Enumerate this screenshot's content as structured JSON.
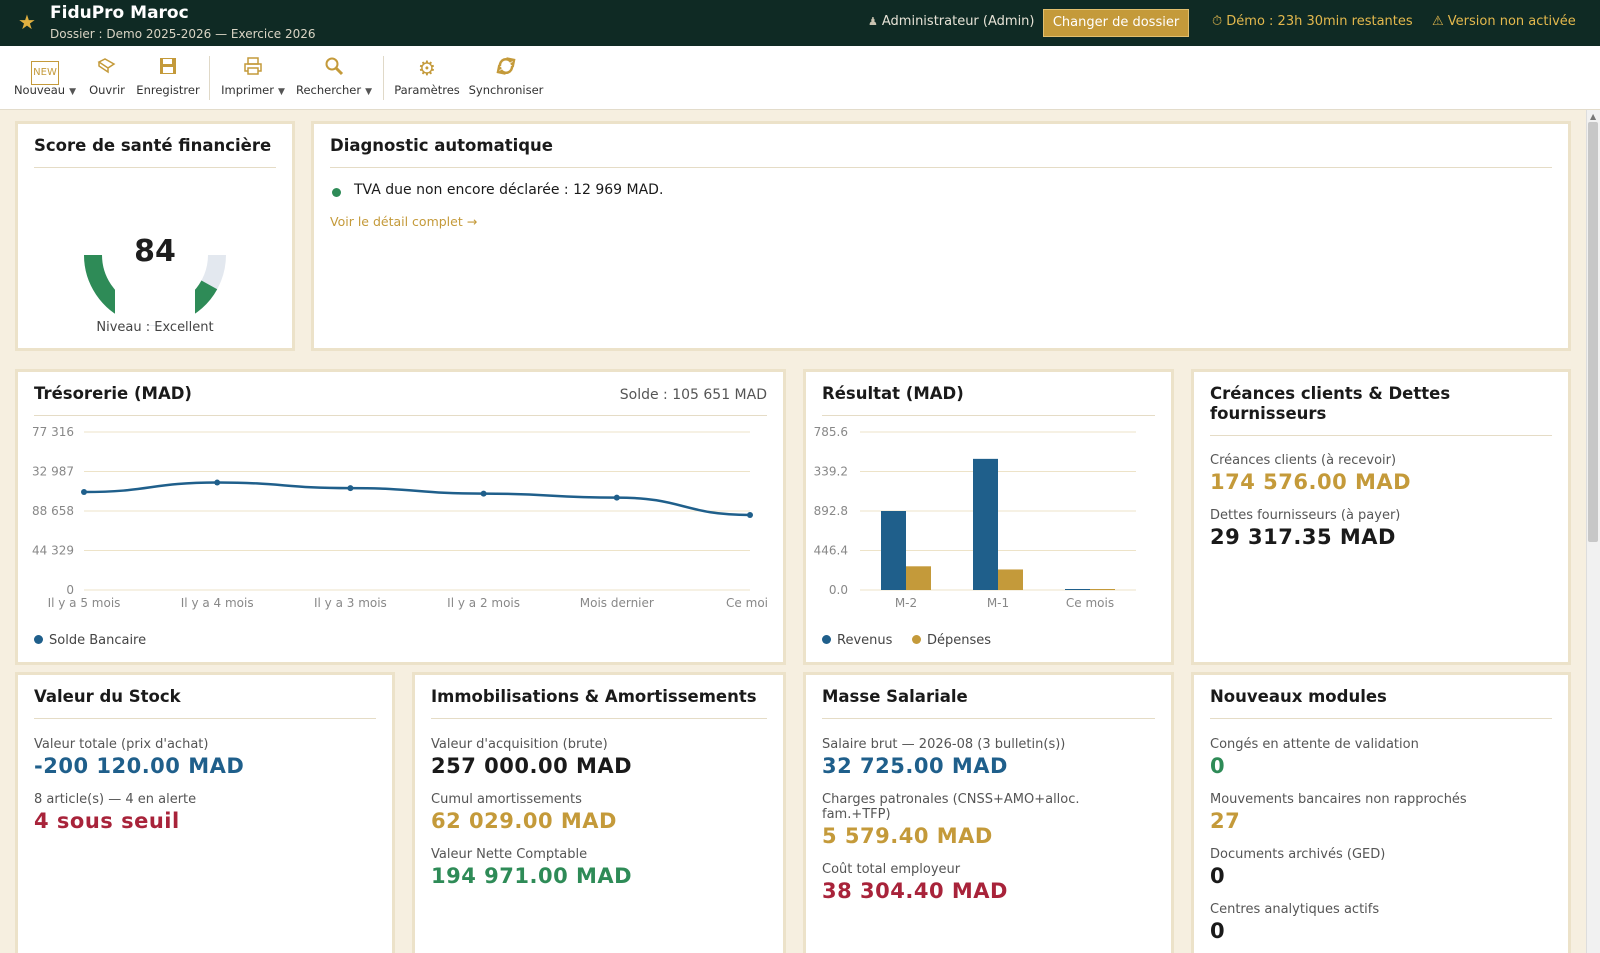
{
  "header": {
    "app_title": "FiduPro Maroc",
    "subtitle": "Dossier : Demo 2025-2026 — Exercice 2026",
    "user": "Administrateur (Admin)",
    "change_button": "Changer de dossier",
    "demo_status": "⏱ Démo : 23h 30min restantes",
    "version_status": "⚠ Version non activée"
  },
  "toolbar": {
    "new_label": "Nouveau",
    "new_icon_text": "NEW",
    "open_label": "Ouvrir",
    "save_label": "Enregistrer",
    "print_label": "Imprimer",
    "search_label": "Rechercher",
    "settings_label": "Paramètres",
    "sync_label": "Synchroniser"
  },
  "health": {
    "title": "Score de santé financière",
    "score": "84",
    "score_value": 84,
    "level": "Niveau : Excellent",
    "color_good": "#2e8b57",
    "color_track": "#e3e8ef"
  },
  "diagnostic": {
    "title": "Diagnostic automatique",
    "item": "TVA due non encore déclarée : 12 969 MAD.",
    "link": "Voir le détail complet →"
  },
  "treasury": {
    "title": "Trésorerie (MAD)",
    "balance": "Solde : 105 651 MAD",
    "legend": "Solde Bancaire"
  },
  "result": {
    "title": "Résultat (MAD)",
    "legend_revenue": "Revenus",
    "legend_expenses": "Dépenses"
  },
  "receivables": {
    "title": "Créances clients & Dettes fournisseurs",
    "clients_label": "Créances clients (à recevoir)",
    "clients_value": "174 576.00 MAD",
    "suppliers_label": "Dettes fournisseurs (à payer)",
    "suppliers_value": "29 317.35 MAD"
  },
  "stock": {
    "title": "Valeur du Stock",
    "total_label": "Valeur totale (prix d'achat)",
    "total_value": "-200 120.00 MAD",
    "alert_label": "8 article(s) — 4 en alerte",
    "alert_value": "4 sous seuil"
  },
  "assets": {
    "title": "Immobilisations & Amortissements",
    "acq_label": "Valeur d'acquisition (brute)",
    "acq_value": "257 000.00 MAD",
    "amort_label": "Cumul amortissements",
    "amort_value": "62 029.00 MAD",
    "net_label": "Valeur Nette Comptable",
    "net_value": "194 971.00 MAD"
  },
  "payroll": {
    "title": "Masse Salariale",
    "gross_label": "Salaire brut — 2026-08 (3 bulletin(s))",
    "gross_value": "32 725.00 MAD",
    "charges_label_1": "Charges patronales (CNSS+AMO+alloc.",
    "charges_label_2": "fam.+TFP)",
    "charges_value": "5 579.40 MAD",
    "cost_label": "Coût total employeur",
    "cost_value": "38 304.40 MAD"
  },
  "modules": {
    "title": "Nouveaux modules",
    "leave_label": "Congés en attente de validation",
    "leave_value": "0",
    "bank_label": "Mouvements bancaires non rapprochés",
    "bank_value": "27",
    "docs_label": "Documents archivés (GED)",
    "docs_value": "0",
    "centers_label": "Centres analytiques actifs",
    "centers_value": "0"
  },
  "chart_data": [
    {
      "type": "line",
      "x": [
        "Il y a 5 mois",
        "Il y a 4 mois",
        "Il y a 3 mois",
        "Il y a 2 mois",
        "Mois dernier",
        "Ce moi"
      ],
      "yticks": [
        "77 316",
        "32 987",
        "88 658",
        "44 329",
        "0"
      ],
      "series": [
        {
          "name": "Solde Bancaire",
          "values": [
            0.62,
            0.68,
            0.645,
            0.61,
            0.585,
            0.475
          ],
          "color": "#1f5f8b"
        }
      ],
      "ylim": [
        0,
        1
      ],
      "grid": true,
      "legend": "bottom-left"
    },
    {
      "type": "bar",
      "categories": [
        "M-2",
        "M-1",
        "Ce mois"
      ],
      "yticks": [
        "785.6",
        "339.2",
        "892.8",
        "446.4",
        "0.0"
      ],
      "series": [
        {
          "name": "Revenus",
          "values": [
            0.5,
            0.83,
            0.005
          ],
          "color": "#1f5f8b"
        },
        {
          "name": "Dépenses",
          "values": [
            0.15,
            0.13,
            0.003
          ],
          "color": "#c49a3a"
        }
      ],
      "ylim": [
        0,
        1
      ],
      "grid": true,
      "legend": "bottom-left"
    }
  ]
}
